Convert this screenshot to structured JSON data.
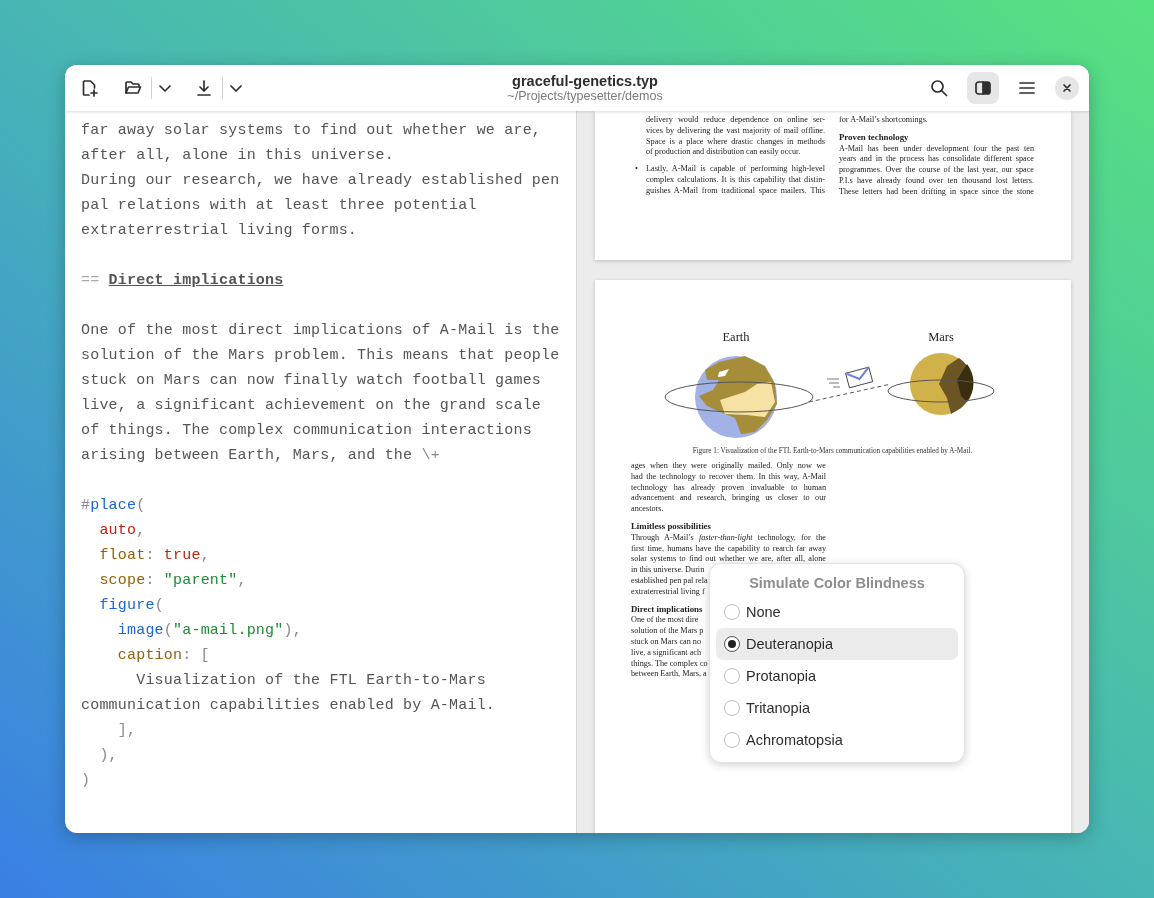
{
  "window": {
    "title": "graceful-genetics.typ",
    "subtitle": "~/Projects/typesetter/demos",
    "preview_toggle": {
      "on": true
    }
  },
  "editor": {
    "blocks": [
      [
        {
          "tokens": [
            {
              "text": "far away solar systems to find out whether we are,",
              "kind": "plain"
            }
          ]
        },
        {
          "tokens": [
            {
              "text": "after all, alone in this universe.",
              "kind": "plain"
            }
          ]
        },
        {
          "tokens": [
            {
              "text": "During our research, we have already established pen",
              "kind": "plain"
            }
          ]
        },
        {
          "tokens": [
            {
              "text": "pal relations with at least three potential",
              "kind": "plain"
            }
          ]
        },
        {
          "tokens": [
            {
              "text": "extraterrestrial living forms.",
              "kind": "plain"
            }
          ]
        }
      ],
      [
        {
          "tokens": [
            {
              "text": "== ",
              "kind": "markup"
            },
            {
              "text": "Direct implications",
              "kind": "heading"
            }
          ]
        }
      ],
      [
        {
          "tokens": [
            {
              "text": "One of the most direct implications of A-Mail is the",
              "kind": "plain"
            }
          ]
        },
        {
          "tokens": [
            {
              "text": "solution of the Mars problem. This means that people",
              "kind": "plain"
            }
          ]
        },
        {
          "tokens": [
            {
              "text": "stuck on Mars can now finally watch football games",
              "kind": "plain"
            }
          ]
        },
        {
          "tokens": [
            {
              "text": "live, a significant achievement on the grand scale",
              "kind": "plain"
            }
          ]
        },
        {
          "tokens": [
            {
              "text": "of things. The complex communication interactions",
              "kind": "plain"
            }
          ]
        },
        {
          "tokens": [
            {
              "text": "arising between Earth, Mars, and the ",
              "kind": "plain"
            },
            {
              "text": "\\+",
              "kind": "punct"
            }
          ]
        }
      ],
      [
        {
          "tokens": [
            {
              "text": "#",
              "kind": "punct"
            },
            {
              "text": "place",
              "kind": "func"
            },
            {
              "text": "(",
              "kind": "punct"
            }
          ]
        },
        {
          "tokens": [
            {
              "text": "  auto",
              "kind": "keyword"
            },
            {
              "text": ",",
              "kind": "punct"
            }
          ]
        },
        {
          "tokens": [
            {
              "text": "  float",
              "kind": "field"
            },
            {
              "text": ": ",
              "kind": "punct"
            },
            {
              "text": "true",
              "kind": "keyword"
            },
            {
              "text": ",",
              "kind": "punct"
            }
          ]
        },
        {
          "tokens": [
            {
              "text": "  scope",
              "kind": "field"
            },
            {
              "text": ": ",
              "kind": "punct"
            },
            {
              "text": "\"parent\"",
              "kind": "string"
            },
            {
              "text": ",",
              "kind": "punct"
            }
          ]
        },
        {
          "tokens": [
            {
              "text": "  figure",
              "kind": "func"
            },
            {
              "text": "(",
              "kind": "punct"
            }
          ]
        },
        {
          "tokens": [
            {
              "text": "    image",
              "kind": "func"
            },
            {
              "text": "(",
              "kind": "punct"
            },
            {
              "text": "\"a-mail.png\"",
              "kind": "string"
            },
            {
              "text": "),",
              "kind": "punct"
            }
          ]
        },
        {
          "tokens": [
            {
              "text": "    caption",
              "kind": "field"
            },
            {
              "text": ": [",
              "kind": "punct"
            }
          ]
        },
        {
          "tokens": [
            {
              "text": "      Visualization of the FTL Earth-to-Mars",
              "kind": "plain"
            }
          ]
        },
        {
          "tokens": [
            {
              "text": "communication capabilities enabled by A-Mail.",
              "kind": "plain"
            }
          ]
        },
        {
          "tokens": [
            {
              "text": "    ],",
              "kind": "punct"
            }
          ]
        },
        {
          "tokens": [
            {
              "text": "  ),",
              "kind": "punct"
            }
          ]
        },
        {
          "tokens": [
            {
              "text": ")",
              "kind": "punct"
            }
          ]
        }
      ]
    ]
  },
  "preview": {
    "page_1": {
      "left_column": [
        {
          "kind": "text",
          "text": "delivery would reduce dependence on online ser-",
          "justify": true
        },
        {
          "kind": "text",
          "text": "vices by delivering the vast majority of mail offline.",
          "justify": true
        },
        {
          "kind": "text",
          "text": "Space is a place where drastic changes in methods",
          "justify": true
        },
        {
          "kind": "text",
          "text": "of production and distribution can easily occur.",
          "justify": false
        },
        {
          "kind": "text",
          "text": "Lastly, A-Mail is capable of performing high-level",
          "justify": true,
          "marker": "•"
        },
        {
          "kind": "text",
          "text": "complex calculations. It is this capability that distin-",
          "justify": true
        },
        {
          "kind": "text",
          "text": "guishes A-Mail from traditional space mailers. This",
          "justify": true
        }
      ],
      "right_column": [
        {
          "kind": "text",
          "text": "for A-Mail’s shortcomings.",
          "justify": false
        },
        {
          "kind": "heading",
          "text": "Proven technology",
          "justify": false
        },
        {
          "kind": "text",
          "text": "A-Mail has been under development four the past ten",
          "justify": true
        },
        {
          "kind": "text",
          "text": "years and in the process has consolidate different space",
          "justify": true
        },
        {
          "kind": "text",
          "text": "programmes. Over the course of the last year, our space",
          "justify": true
        },
        {
          "kind": "text",
          "text": "P.I.s have already found over ten thousand lost letters.",
          "justify": true
        },
        {
          "kind": "text",
          "text": "These letters had been drifting in space since the stone",
          "justify": true
        }
      ]
    },
    "page_2": {
      "figure": {
        "left_label": "Earth",
        "right_label": "Mars",
        "caption": "Figure 1:  Visualization of the FTL Earth-to-Mars communication capabilities enabled by A-Mail."
      },
      "column": [
        {
          "kind": "text",
          "text": "ages when they were originally mailed. Only now we",
          "justify": true
        },
        {
          "kind": "text",
          "text": "had the technology to recover them. In this way, A-Mail",
          "justify": true
        },
        {
          "kind": "text",
          "text": "technology has already proven invaluable to human",
          "justify": true
        },
        {
          "kind": "text",
          "text": "advancement and research, bringing us closer to our",
          "justify": true
        },
        {
          "kind": "text",
          "text": "ancestors.",
          "justify": false
        },
        {
          "kind": "heading",
          "text": "Limitless possibilities",
          "justify": false
        },
        {
          "kind": "text",
          "text": "Through A-Mail’s *faster-than-light* technology, for the",
          "justify": true
        },
        {
          "kind": "text",
          "text": "first time, humans have the capability to rearch far away",
          "justify": true
        },
        {
          "kind": "text",
          "text": "solar systems to find out whether we are, after all, alone",
          "justify": true
        },
        {
          "kind": "text",
          "text": "in this universe. Durin",
          "justify": false
        },
        {
          "kind": "text",
          "text": "established pen pal rela",
          "justify": false
        },
        {
          "kind": "text",
          "text": "extraterrestrial living f",
          "justify": false
        },
        {
          "kind": "heading",
          "text": "Direct implications",
          "justify": false
        },
        {
          "kind": "text",
          "text": "One of the most dire",
          "justify": false
        },
        {
          "kind": "text",
          "text": "solution of the Mars p",
          "justify": false
        },
        {
          "kind": "text",
          "text": "stuck on Mars can no",
          "justify": false
        },
        {
          "kind": "text",
          "text": "live, a significant ach",
          "justify": false
        },
        {
          "kind": "text",
          "text": "things. The complex co",
          "justify": false
        },
        {
          "kind": "text",
          "text": "between Earth, Mars, a",
          "justify": false
        }
      ]
    }
  },
  "color_popup": {
    "title": "Simulate Color Blindness",
    "options": [
      {
        "label": "None",
        "selected": false
      },
      {
        "label": "Deuteranopia",
        "selected": true
      },
      {
        "label": "Protanopia",
        "selected": false
      },
      {
        "label": "Tritanopia",
        "selected": false
      },
      {
        "label": "Achromatopsia",
        "selected": false
      }
    ]
  }
}
